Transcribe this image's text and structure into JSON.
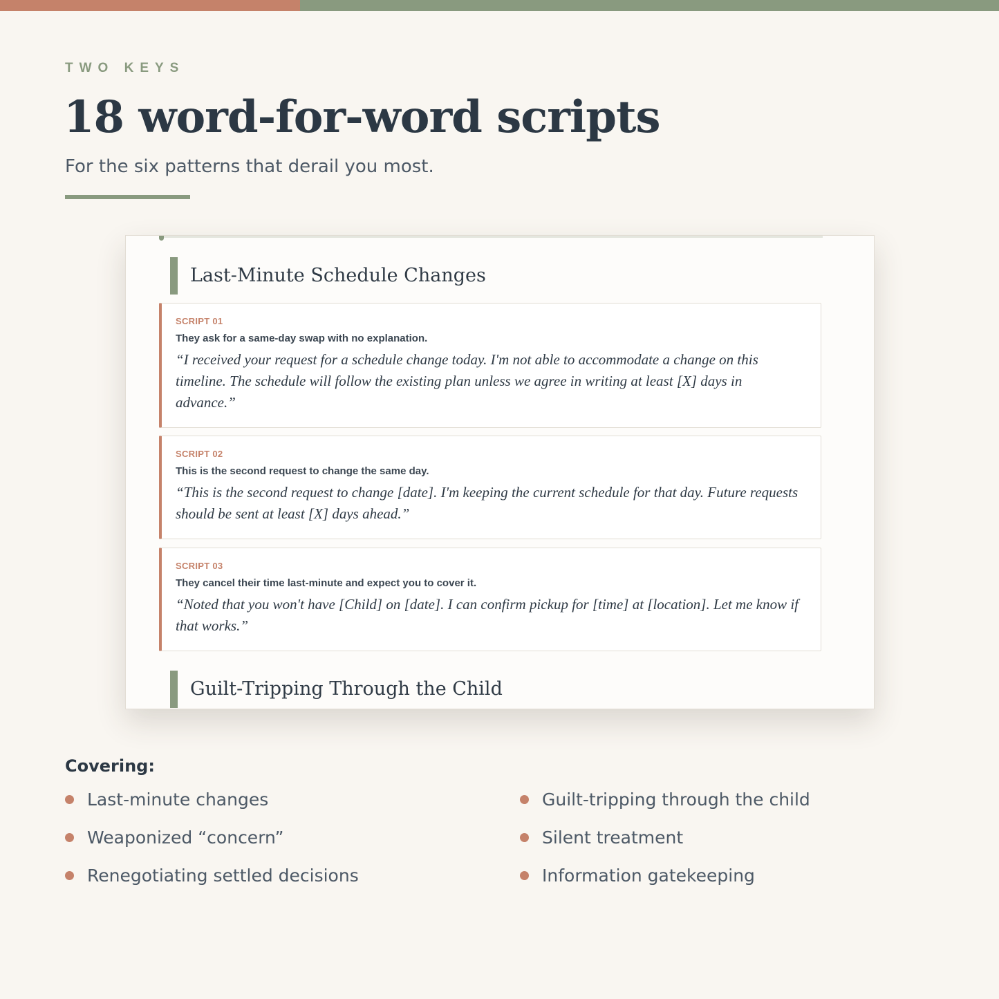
{
  "header": {
    "eyebrow": "TWO KEYS",
    "title": "18 word-for-word scripts",
    "subtitle": "For the six patterns that derail you most."
  },
  "preview": {
    "section_1": "Last-Minute Schedule Changes",
    "scripts": [
      {
        "label": "SCRIPT 01",
        "context": "They ask for a same-day swap with no explanation.",
        "quote": "“I received your request for a schedule change today. I'm not able to accommodate a change on this timeline. The schedule will follow the existing plan unless we agree in writing at least [X] days in advance.”"
      },
      {
        "label": "SCRIPT 02",
        "context": "This is the second request to change the same day.",
        "quote": "“This is the second request to change [date]. I'm keeping the current schedule for that day. Future requests should be sent at least [X] days ahead.”"
      },
      {
        "label": "SCRIPT 03",
        "context": "They cancel their time last-minute and expect you to cover it.",
        "quote": "“Noted that you won't have [Child] on [date]. I can confirm pickup for [time] at [location]. Let me know if that works.”"
      }
    ],
    "section_2": "Guilt-Tripping Through the Child"
  },
  "covering": {
    "label": "Covering:",
    "items": [
      "Last-minute changes",
      "Weaponized “concern”",
      "Renegotiating settled decisions",
      "Guilt-tripping through the child",
      "Silent treatment",
      "Information gatekeeping"
    ]
  },
  "colors": {
    "accent_terracotta": "#c5826a",
    "accent_sage": "#899a7f",
    "text_dark": "#2c3844",
    "background": "#f9f6f1"
  }
}
